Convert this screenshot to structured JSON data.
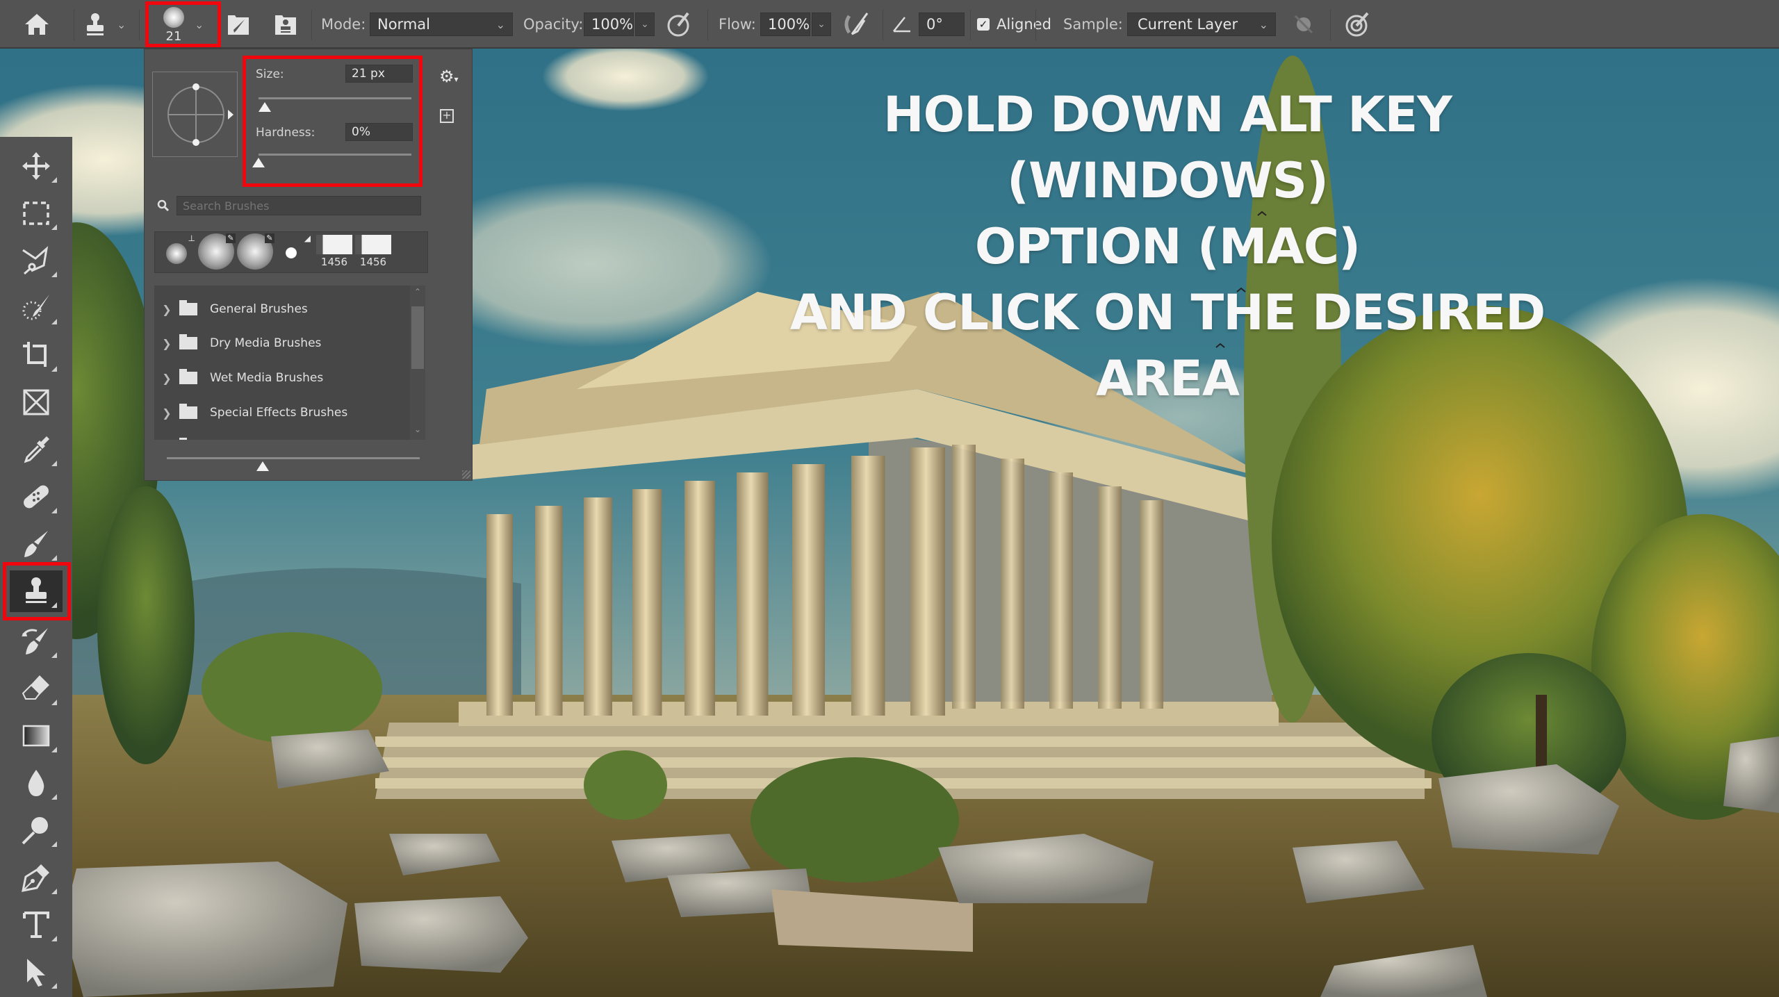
{
  "app": "Adobe Photoshop",
  "options_bar": {
    "home_icon": "home-icon",
    "tool_preset_icon": "clone-stamp-icon",
    "brush_size_value": "21",
    "brush_settings_icon": "brush-settings-panel-icon",
    "clone_source_icon": "clone-source-panel-icon",
    "mode_label": "Mode:",
    "mode_value": "Normal",
    "opacity_label": "Opacity:",
    "opacity_value": "100%",
    "pressure_opacity_icon": "pressure-opacity-icon",
    "flow_label": "Flow:",
    "flow_value": "100%",
    "airbrush_icon": "airbrush-icon",
    "angle_icon": "angle-icon",
    "angle_value": "0°",
    "aligned_label": "Aligned",
    "aligned_checked": true,
    "sample_label": "Sample:",
    "sample_value": "Current Layer",
    "ignore_adjustment_icon": "ignore-adjustment-layers-icon",
    "pressure_size_icon": "pressure-size-icon"
  },
  "brush_panel": {
    "size_label": "Size:",
    "size_value": "21 px",
    "size_fraction": 0.04,
    "hardness_label": "Hardness:",
    "hardness_value": "0%",
    "hardness_fraction": 0.0,
    "search_placeholder": "Search Brushes",
    "presets": [
      {
        "type": "soft-round",
        "badge": "stamp"
      },
      {
        "type": "soft-round-large",
        "badge": "brush"
      },
      {
        "type": "soft-round-large",
        "badge": "brush"
      },
      {
        "type": "hard-round-small",
        "badge": "eraser"
      },
      {
        "type": "sampled",
        "label": "1456"
      },
      {
        "type": "sampled",
        "label": "1456"
      }
    ],
    "folders": [
      "General Brushes",
      "Dry Media Brushes",
      "Wet Media Brushes",
      "Special Effects Brushes"
    ],
    "preview_size_fraction": 0.38
  },
  "toolbar": {
    "tools": [
      {
        "name": "move-tool"
      },
      {
        "name": "rectangular-marquee-tool"
      },
      {
        "name": "lasso-tool"
      },
      {
        "name": "quick-selection-tool"
      },
      {
        "name": "crop-tool"
      },
      {
        "name": "frame-tool"
      },
      {
        "name": "eyedropper-tool"
      },
      {
        "name": "spot-healing-brush-tool"
      },
      {
        "name": "brush-tool"
      },
      {
        "name": "clone-stamp-tool",
        "active": true
      },
      {
        "name": "history-brush-tool"
      },
      {
        "name": "eraser-tool"
      },
      {
        "name": "gradient-tool"
      },
      {
        "name": "blur-tool"
      },
      {
        "name": "dodge-tool"
      },
      {
        "name": "pen-tool"
      },
      {
        "name": "type-tool"
      },
      {
        "name": "path-selection-tool"
      }
    ]
  },
  "overlay": {
    "line1": "HOLD DOWN ALT KEY (WINDOWS)",
    "line2": "OPTION (MAC)",
    "line3": "AND CLICK ON THE DESIRED AREA"
  },
  "highlight_color": "#f0060c"
}
